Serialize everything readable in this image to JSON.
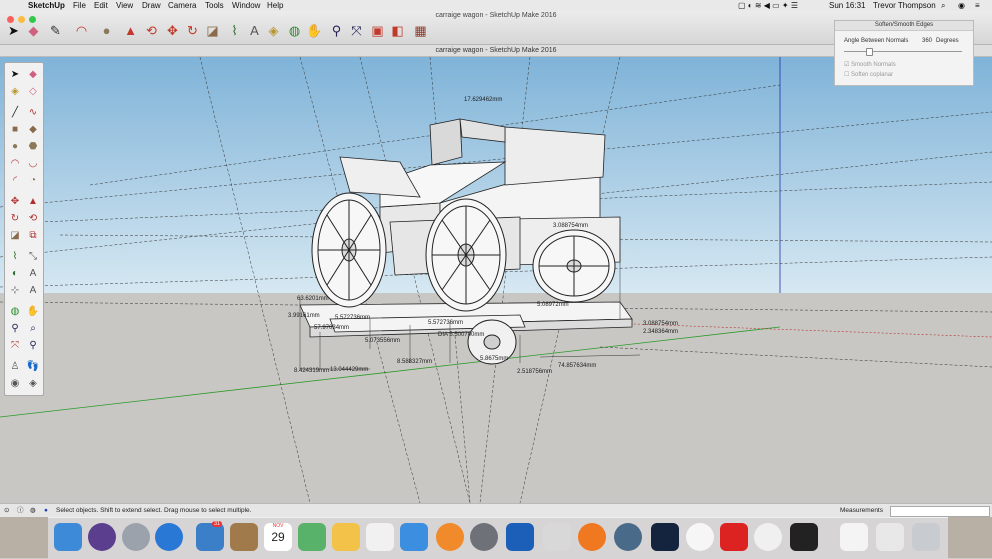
{
  "menubar": {
    "app_name": "SketchUp",
    "menus": [
      "File",
      "Edit",
      "View",
      "Draw",
      "Camera",
      "Tools",
      "Window",
      "Help"
    ],
    "clock": "Sun 16:31",
    "user": "Trevor Thompson"
  },
  "window": {
    "title": "carraige wagon - SketchUp Make 2016",
    "subtitle": "carraige wagon - SketchUp Make 2016"
  },
  "tray": {
    "title": "Soften/Smooth Edges",
    "angle_label": "Angle Between Normals",
    "angle_value": "360",
    "angle_unit": "Degrees",
    "smooth_normals": "Smooth Normals",
    "soften_coplanar": "Soften coplanar"
  },
  "status": {
    "text": "Select objects. Shift to extend select. Drag mouse to select multiple.",
    "measurements_label": "Measurements"
  },
  "dimensions": [
    "17.629462mm",
    "63.6201mm",
    "3.99161mm",
    "5.572736mm",
    "57.97034mm",
    "5.572736mm",
    "5.073556mm",
    "8.588327mm",
    "8.424319mm",
    "13.044429mm",
    "DIA 5.500700mm",
    "5.8675mm",
    "2.518756mm",
    "74.857634mm",
    "3.088754mm",
    "2.348364mm",
    "3.088754mm",
    "5.08972mm"
  ],
  "dock": {
    "calendar_month": "NOV",
    "calendar_day": "29",
    "badge": "31"
  },
  "colors": {
    "sky": "#a9cde3",
    "ground": "#c9c7c3",
    "accent": "#c0392b"
  }
}
